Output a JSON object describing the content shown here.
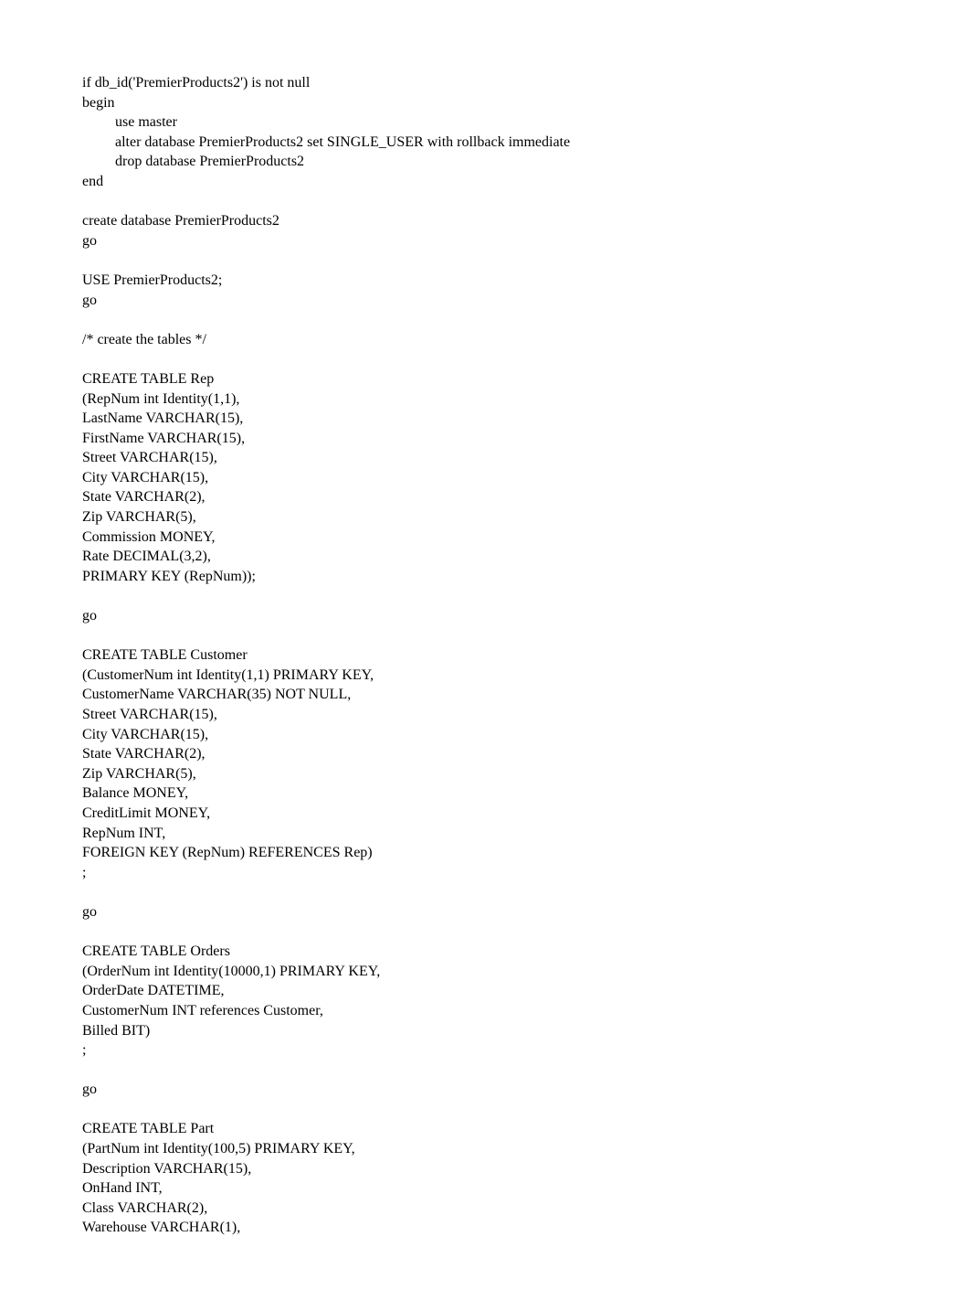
{
  "lines": [
    {
      "text": "if db_id('PremierProducts2') is not null",
      "indent": 0
    },
    {
      "text": "begin",
      "indent": 0
    },
    {
      "text": "use master",
      "indent": 1
    },
    {
      "text": "alter database PremierProducts2 set SINGLE_USER with rollback immediate",
      "indent": 1
    },
    {
      "text": "drop database PremierProducts2",
      "indent": 1
    },
    {
      "text": "end",
      "indent": 0
    },
    {
      "text": "",
      "indent": 0
    },
    {
      "text": "create database PremierProducts2",
      "indent": 0
    },
    {
      "text": "go",
      "indent": 0
    },
    {
      "text": "",
      "indent": 0
    },
    {
      "text": "USE PremierProducts2;",
      "indent": 0
    },
    {
      "text": "go",
      "indent": 0
    },
    {
      "text": "",
      "indent": 0
    },
    {
      "text": "/* create the tables */",
      "indent": 0
    },
    {
      "text": "",
      "indent": 0
    },
    {
      "text": "CREATE TABLE Rep",
      "indent": 0
    },
    {
      "text": "(RepNum int Identity(1,1),",
      "indent": 0
    },
    {
      "text": "LastName VARCHAR(15),",
      "indent": 0
    },
    {
      "text": "FirstName VARCHAR(15),",
      "indent": 0
    },
    {
      "text": "Street VARCHAR(15),",
      "indent": 0
    },
    {
      "text": "City VARCHAR(15),",
      "indent": 0
    },
    {
      "text": "State VARCHAR(2),",
      "indent": 0
    },
    {
      "text": "Zip VARCHAR(5),",
      "indent": 0
    },
    {
      "text": "Commission MONEY,",
      "indent": 0
    },
    {
      "text": "Rate DECIMAL(3,2),",
      "indent": 0
    },
    {
      "text": "PRIMARY KEY (RepNum));",
      "indent": 0
    },
    {
      "text": "",
      "indent": 0
    },
    {
      "text": "go",
      "indent": 0
    },
    {
      "text": "",
      "indent": 0
    },
    {
      "text": "CREATE TABLE Customer",
      "indent": 0
    },
    {
      "text": "(CustomerNum int Identity(1,1) PRIMARY KEY,",
      "indent": 0
    },
    {
      "text": "CustomerName VARCHAR(35) NOT NULL,",
      "indent": 0
    },
    {
      "text": "Street VARCHAR(15),",
      "indent": 0
    },
    {
      "text": "City VARCHAR(15),",
      "indent": 0
    },
    {
      "text": "State VARCHAR(2),",
      "indent": 0
    },
    {
      "text": "Zip VARCHAR(5),",
      "indent": 0
    },
    {
      "text": "Balance MONEY,",
      "indent": 0
    },
    {
      "text": "CreditLimit MONEY,",
      "indent": 0
    },
    {
      "text": "RepNum INT,",
      "indent": 0
    },
    {
      "text": "FOREIGN KEY (RepNum) REFERENCES Rep)",
      "indent": 0
    },
    {
      "text": ";",
      "indent": 0
    },
    {
      "text": "",
      "indent": 0
    },
    {
      "text": "go",
      "indent": 0
    },
    {
      "text": "",
      "indent": 0
    },
    {
      "text": "CREATE TABLE Orders",
      "indent": 0
    },
    {
      "text": "(OrderNum int Identity(10000,1) PRIMARY KEY,",
      "indent": 0
    },
    {
      "text": "OrderDate DATETIME,",
      "indent": 0
    },
    {
      "text": "CustomerNum INT references Customer,",
      "indent": 0
    },
    {
      "text": "Billed BIT)",
      "indent": 0
    },
    {
      "text": ";",
      "indent": 0
    },
    {
      "text": "",
      "indent": 0
    },
    {
      "text": "go",
      "indent": 0
    },
    {
      "text": "",
      "indent": 0
    },
    {
      "text": "CREATE TABLE Part",
      "indent": 0
    },
    {
      "text": "(PartNum int Identity(100,5) PRIMARY KEY,",
      "indent": 0
    },
    {
      "text": "Description VARCHAR(15),",
      "indent": 0
    },
    {
      "text": "OnHand INT,",
      "indent": 0
    },
    {
      "text": "Class VARCHAR(2),",
      "indent": 0
    },
    {
      "text": "Warehouse VARCHAR(1),",
      "indent": 0
    }
  ]
}
